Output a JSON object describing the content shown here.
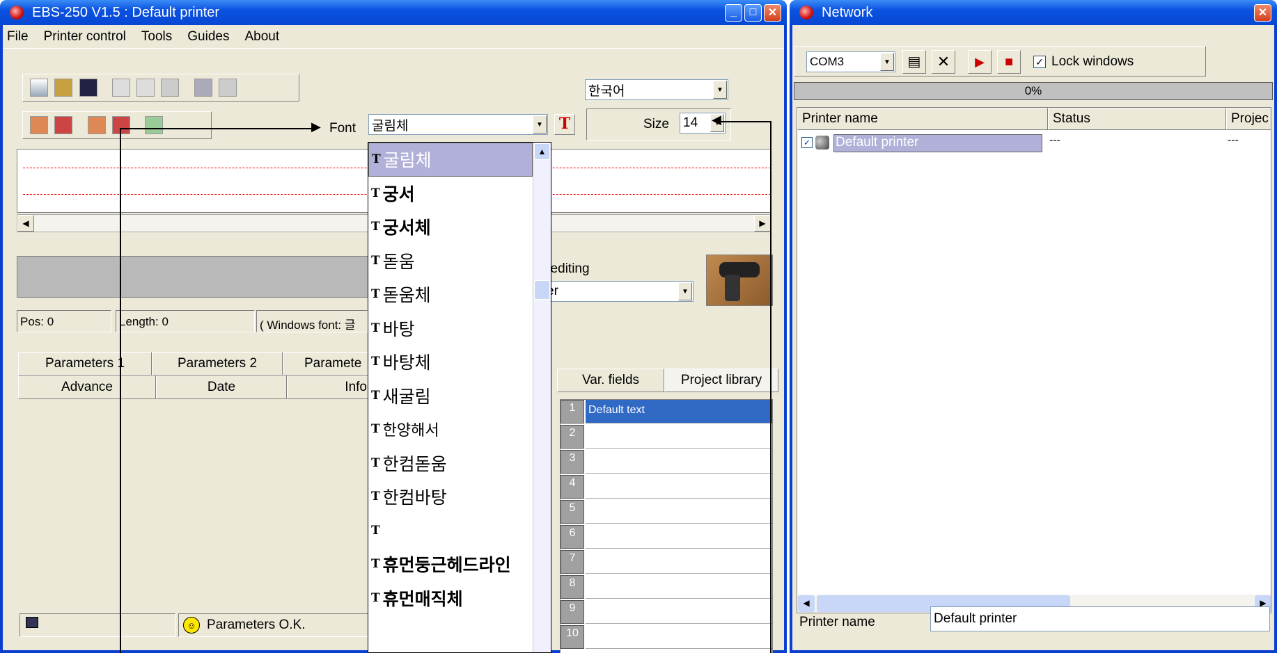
{
  "main_window": {
    "title": "EBS-250 V1.5 : Default printer",
    "menu": [
      "File",
      "Printer control",
      "Tools",
      "Guides",
      "About"
    ],
    "language": "한국어",
    "font_label": "Font",
    "font_value": "굴림체",
    "size_label": "Size",
    "size_value": "14",
    "soft_editing_label": "t editing",
    "soft_editing_value": "er",
    "pos_label": "Pos: 0",
    "length_label": "Length: 0",
    "windows_font_label": "( Windows font: 글",
    "tabs_row1": [
      "Parameters 1",
      "Parameters 2",
      "Paramete"
    ],
    "tabs_row2": [
      "Advance",
      "Date",
      "Info"
    ],
    "right_tabs": [
      "Var. fields",
      "Project library"
    ],
    "var_fields": [
      {
        "num": "1",
        "text": "Default text"
      },
      {
        "num": "2",
        "text": ""
      },
      {
        "num": "3",
        "text": ""
      },
      {
        "num": "4",
        "text": ""
      },
      {
        "num": "5",
        "text": ""
      },
      {
        "num": "6",
        "text": ""
      },
      {
        "num": "7",
        "text": ""
      },
      {
        "num": "8",
        "text": ""
      },
      {
        "num": "9",
        "text": ""
      },
      {
        "num": "10",
        "text": ""
      }
    ],
    "status_text": "Parameters O.K."
  },
  "font_dropdown": {
    "items": [
      "굴림체",
      "궁서",
      "궁서체",
      "돋움",
      "돋움체",
      "바탕",
      "바탕체",
      "새굴림",
      "한양해서",
      "한컴돋움",
      "한컴바탕",
      "",
      "휴먼둥근헤드라인",
      "휴먼매직체"
    ],
    "selected_index": 0
  },
  "network_window": {
    "title": "Network",
    "port": "COM3",
    "lock_windows_label": "Lock windows",
    "lock_windows_checked": true,
    "progress_text": "0%",
    "columns": [
      "Printer name",
      "Status",
      "Projec"
    ],
    "rows": [
      {
        "name": "Default printer",
        "status": "---",
        "project": "---"
      }
    ],
    "printer_name_label": "Printer name",
    "printer_name_value": "Default printer"
  },
  "colors": {
    "title_blue": "#0a52e0",
    "selection": "#316ac5",
    "face": "#ece9d8"
  }
}
